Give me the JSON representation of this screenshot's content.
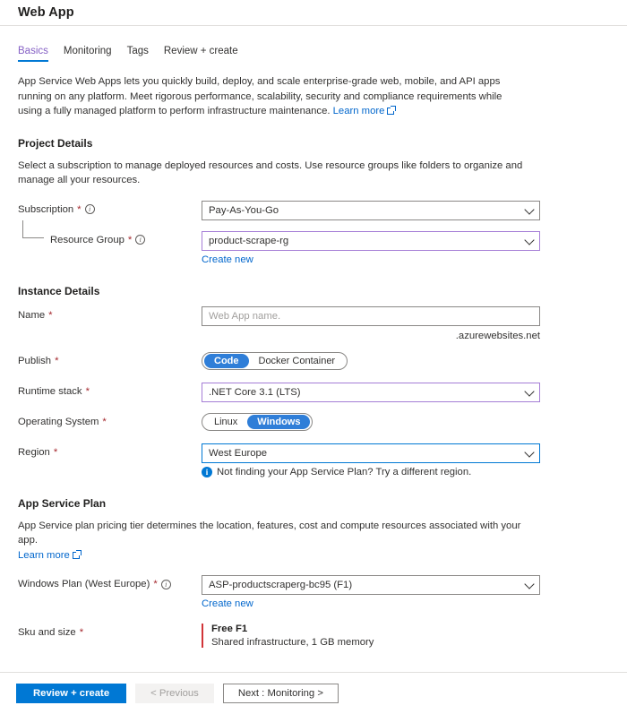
{
  "header": {
    "title": "Web App"
  },
  "tabs": [
    {
      "label": "Basics",
      "active": true
    },
    {
      "label": "Monitoring",
      "active": false
    },
    {
      "label": "Tags",
      "active": false
    },
    {
      "label": "Review + create",
      "active": false
    }
  ],
  "intro": {
    "text": "App Service Web Apps lets you quickly build, deploy, and scale enterprise-grade web, mobile, and API apps running on any platform. Meet rigorous performance, scalability, security and compliance requirements while using a fully managed platform to perform infrastructure maintenance.",
    "learn_more": "Learn more"
  },
  "project_details": {
    "title": "Project Details",
    "description": "Select a subscription to manage deployed resources and costs. Use resource groups like folders to organize and manage all your resources.",
    "subscription": {
      "label": "Subscription",
      "required": "*",
      "value": "Pay-As-You-Go"
    },
    "resource_group": {
      "label": "Resource Group",
      "required": "*",
      "value": "product-scrape-rg",
      "create_new": "Create new"
    }
  },
  "instance_details": {
    "title": "Instance Details",
    "name": {
      "label": "Name",
      "required": "*",
      "value": "",
      "placeholder": "Web App name.",
      "suffix": ".azurewebsites.net"
    },
    "publish": {
      "label": "Publish",
      "required": "*",
      "options": [
        "Code",
        "Docker Container"
      ],
      "selected": "Code"
    },
    "runtime_stack": {
      "label": "Runtime stack",
      "required": "*",
      "value": ".NET Core 3.1 (LTS)"
    },
    "operating_system": {
      "label": "Operating System",
      "required": "*",
      "options": [
        "Linux",
        "Windows"
      ],
      "selected": "Windows"
    },
    "region": {
      "label": "Region",
      "required": "*",
      "value": "West Europe",
      "hint": "Not finding your App Service Plan? Try a different region."
    }
  },
  "app_service_plan": {
    "title": "App Service Plan",
    "description": "App Service plan pricing tier determines the location, features, cost and compute resources associated with your app.",
    "learn_more": "Learn more",
    "windows_plan": {
      "label": "Windows Plan (West Europe)",
      "required": "*",
      "value": "ASP-productscraperg-bc95 (F1)",
      "create_new": "Create new"
    },
    "sku": {
      "label": "Sku and size",
      "required": "*",
      "title": "Free F1",
      "description": "Shared infrastructure, 1 GB memory"
    }
  },
  "footer": {
    "review_create": "Review + create",
    "previous": "< Previous",
    "next": "Next : Monitoring >"
  },
  "colors": {
    "accent_blue": "#0078d4",
    "tab_active": "#8661c5",
    "required_red": "#a4262c",
    "sku_bar_red": "#d13438",
    "field_purple": "#a57dd6",
    "link_blue": "#0066cc"
  }
}
